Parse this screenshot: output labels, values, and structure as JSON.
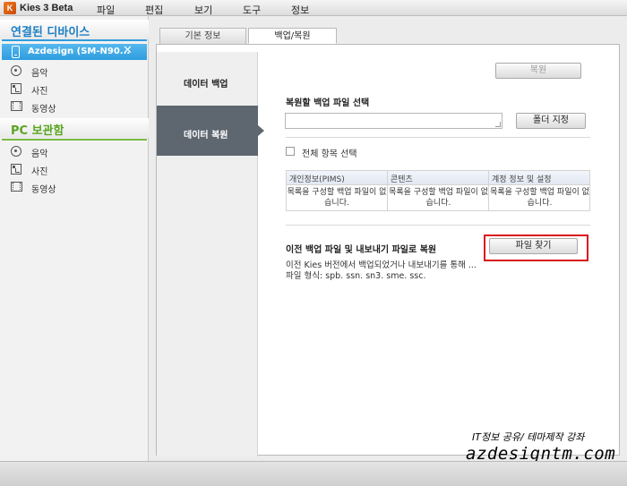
{
  "app": {
    "title": "Kies 3 Beta",
    "logo_letter": "K",
    "menu": [
      "파일",
      "편집",
      "보기",
      "도구",
      "정보"
    ]
  },
  "sidebar": {
    "connected_header": "연결된 디바이스",
    "device_name": "Azdesign (SM-N90...",
    "device_close": "✕",
    "device_items": [
      "음악",
      "사진",
      "동영상"
    ],
    "pc_header": "PC 보관함",
    "pc_items": [
      "음악",
      "사진",
      "동영상"
    ]
  },
  "tabs": {
    "basic_info": "기본 정보",
    "backup_restore": "백업/복원"
  },
  "left_menu": {
    "backup": "데이터 백업",
    "restore": "데이터 복원"
  },
  "restore": {
    "restore_button": "복원",
    "select_file_label": "복원할 백업 파일 선택",
    "file_path_value": "",
    "folder_button": "폴더 지정",
    "select_all_label": "전체 항목 선택",
    "table": {
      "headers": [
        "개인정보(PIMS)",
        "콘텐츠",
        "계정 정보 및 설정"
      ],
      "cells": [
        "목록을 구성할 백업 파일이 없습니다.",
        "목록을 구성할 백업 파일이 없습니다.",
        "목록을 구성할 백업 파일이 없습니다."
      ]
    },
    "prev_backup_label": "이전 백업 파일 및 내보내기 파일로 복원",
    "find_file_button": "파일 찾기",
    "prev_desc": "이전 Kies 버전에서 백업되었거나 내보내기를 통해 ...",
    "file_format": "파일 형식: spb. ssn. sn3. sme. ssc."
  },
  "watermark": {
    "line1": "IT정보 공유/ 테마제작 강좌",
    "line2": "azdesigntm.com"
  },
  "colors": {
    "highlight": "#d9171d",
    "device_selected": "#2f9ddf",
    "connected_header": "#1c7fc4",
    "pc_header": "#5aa522"
  }
}
